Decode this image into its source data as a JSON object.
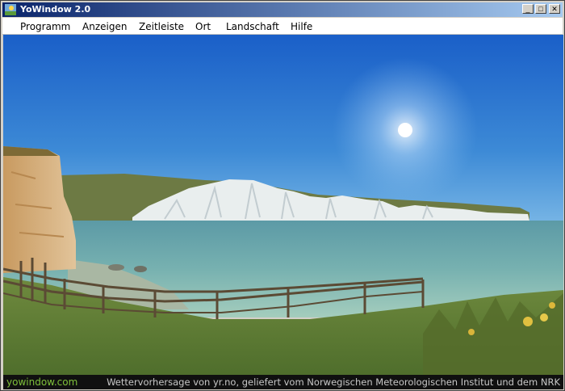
{
  "window": {
    "title": "YoWindow 2.0",
    "controls": {
      "minimize": "_",
      "maximize": "□",
      "close": "✕"
    }
  },
  "menu": {
    "items": [
      "Programm",
      "Anzeigen",
      "Zeitleiste",
      "Ort",
      "Landschaft",
      "Hilfe"
    ]
  },
  "status": {
    "left": "yowindow.com",
    "right": "Wettervorhersage von yr.no, geliefert vom Norwegischen Meteorologischen Institut und dem NRK"
  },
  "colors": {
    "title_gradient_start": "#0a246a",
    "title_gradient_end": "#a6caf0",
    "status_link": "#7ec03a"
  }
}
